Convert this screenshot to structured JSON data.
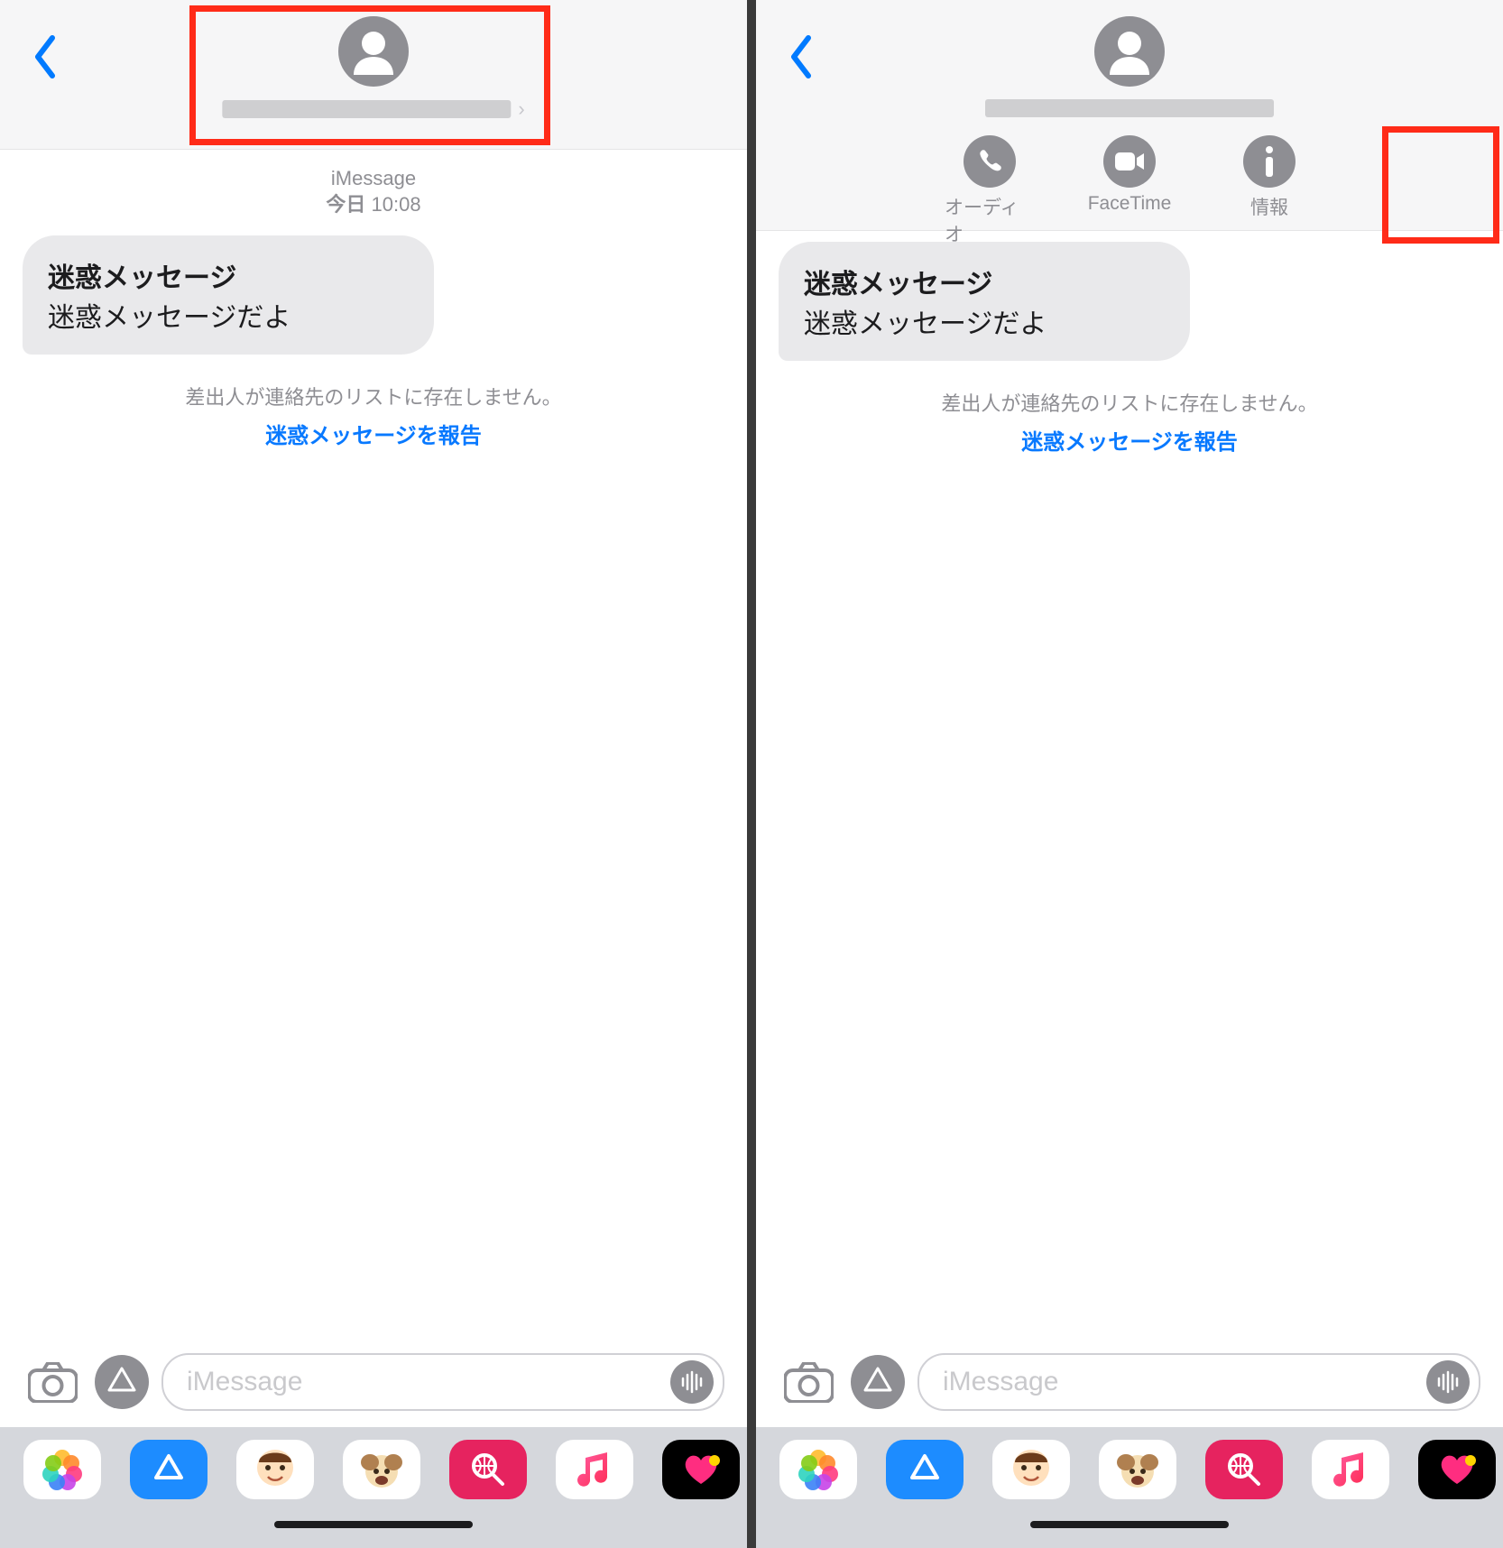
{
  "left": {
    "header": {
      "avatar": "person-icon",
      "name_masked": true
    },
    "meta": {
      "service": "iMessage",
      "timestamp_prefix": "今日",
      "timestamp_time": "10:08"
    },
    "message": {
      "title": "迷惑メッセージ",
      "body": "迷惑メッセージだよ"
    },
    "notice": {
      "line1": "差出人が連絡先のリストに存在しません。",
      "report_link": "迷惑メッセージを報告"
    },
    "input": {
      "placeholder": "iMessage"
    }
  },
  "right": {
    "header": {
      "avatar": "person-icon",
      "name_masked": true,
      "actions": [
        {
          "icon": "phone-icon",
          "label": "オーディオ"
        },
        {
          "icon": "video-icon",
          "label": "FaceTime"
        },
        {
          "icon": "info-icon",
          "label": "情報"
        }
      ]
    },
    "message": {
      "title": "迷惑メッセージ",
      "body": "迷惑メッセージだよ"
    },
    "notice": {
      "line1": "差出人が連絡先のリストに存在しません。",
      "report_link": "迷惑メッセージを報告"
    },
    "input": {
      "placeholder": "iMessage"
    }
  },
  "appstrip": [
    {
      "name": "photos-icon",
      "bg": "#ffffff"
    },
    {
      "name": "appstore-icon",
      "bg": "#1d8cff"
    },
    {
      "name": "memoji1-icon",
      "bg": "#ffffff"
    },
    {
      "name": "memoji2-icon",
      "bg": "#ffffff"
    },
    {
      "name": "search-icon",
      "bg": "#e6235f"
    },
    {
      "name": "music-icon",
      "bg": "#ffffff"
    },
    {
      "name": "digitaltouch-icon",
      "bg": "#000000"
    },
    {
      "name": "extra-icon",
      "bg": "#ffffff"
    }
  ],
  "colors": {
    "ios_blue": "#007aff",
    "bubble_grey": "#e9e9eb",
    "meta_grey": "#8e8e93",
    "callout_red": "#ff2b18",
    "link_blue": "#0879ff"
  },
  "callouts": {
    "left_header_box": true,
    "right_info_box": true
  }
}
